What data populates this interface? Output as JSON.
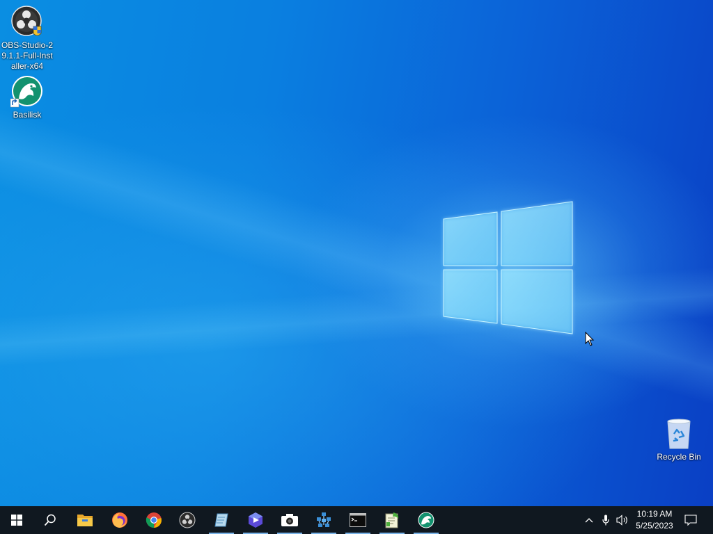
{
  "desktop": {
    "icons": [
      {
        "label": "OBS-Studio-29.1.1-Full-Installer-x64",
        "icon": "obs-installer-icon"
      },
      {
        "label": "Basilisk",
        "icon": "basilisk-icon"
      },
      {
        "label": "Recycle Bin",
        "icon": "recycle-bin-icon"
      }
    ]
  },
  "taskbar": {
    "start": "windows-start-icon",
    "search": "search-icon",
    "pinned": [
      {
        "icon": "file-explorer-icon",
        "running": false
      },
      {
        "icon": "firefox-icon",
        "running": false
      },
      {
        "icon": "chrome-icon",
        "running": false
      },
      {
        "icon": "obs-icon",
        "running": false
      },
      {
        "icon": "notes-app-icon",
        "running": true
      },
      {
        "icon": "media-player-icon",
        "running": true
      },
      {
        "icon": "camera-screenshot-icon",
        "running": true
      },
      {
        "icon": "network-tool-icon",
        "running": true
      },
      {
        "icon": "terminal-icon",
        "running": true
      },
      {
        "icon": "notepad-plus-icon",
        "running": true
      },
      {
        "icon": "basilisk-icon",
        "running": true
      }
    ],
    "tray": {
      "chevron": "chevron-up-icon",
      "mic": "microphone-icon",
      "volume": "volume-icon",
      "time": "10:19 AM",
      "date": "5/25/2023",
      "notifications": "notification-icon"
    }
  },
  "colors": {
    "taskbar_bg": "#101820",
    "wallpaper_blue": "#0a7fe0",
    "running_indicator": "#7ab4e8"
  }
}
